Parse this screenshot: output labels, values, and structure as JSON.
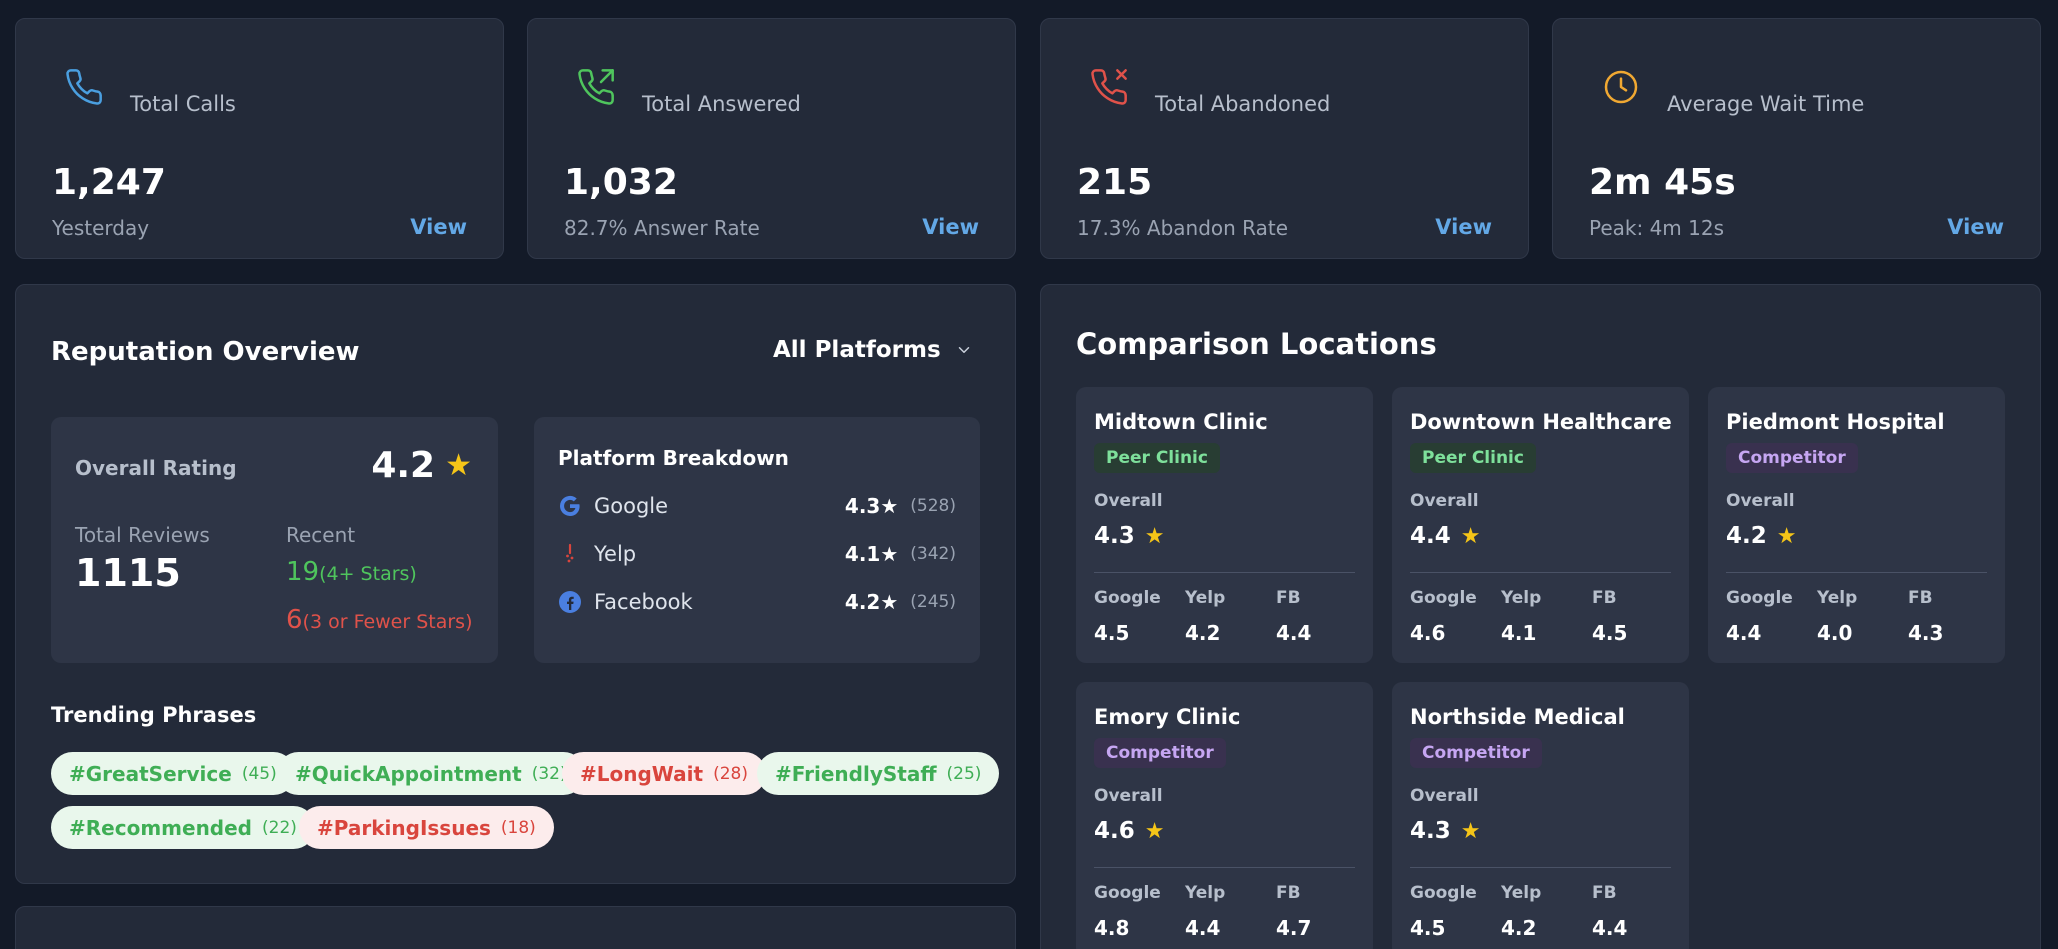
{
  "stats": [
    {
      "title": "Total Calls",
      "value": "1,247",
      "sub": "Yesterday",
      "view": "View",
      "icon": "phone-icon",
      "color": "#4a9fe0"
    },
    {
      "title": "Total Answered",
      "value": "1,032",
      "sub": "82.7% Answer Rate",
      "view": "View",
      "icon": "phone-outgoing-icon",
      "color": "#4fc55d"
    },
    {
      "title": "Total Abandoned",
      "value": "215",
      "sub": "17.3% Abandon Rate",
      "view": "View",
      "icon": "phone-missed-icon",
      "color": "#e0524a"
    },
    {
      "title": "Average Wait Time",
      "value": "2m 45s",
      "sub": "Peak: 4m 12s",
      "view": "View",
      "icon": "clock-icon",
      "color": "#f0a832"
    }
  ],
  "reputation": {
    "title": "Reputation Overview",
    "platform_filter": "All Platforms",
    "overall_label": "Overall Rating",
    "overall_value": "4.2",
    "total_reviews_label": "Total Reviews",
    "total_reviews_value": "1115",
    "recent_label": "Recent",
    "recent_positive_count": "19",
    "recent_positive_text": "(4+ Stars)",
    "recent_negative_count": "6",
    "recent_negative_text": "(3 or Fewer Stars)",
    "breakdown_title": "Platform Breakdown",
    "platforms": [
      {
        "name": "Google",
        "rating": "4.3★",
        "count": "(528)",
        "icon": "google-icon"
      },
      {
        "name": "Yelp",
        "rating": "4.1★",
        "count": "(342)",
        "icon": "yelp-icon"
      },
      {
        "name": "Facebook",
        "rating": "4.2★",
        "count": "(245)",
        "icon": "facebook-icon"
      }
    ],
    "trending_title": "Trending Phrases",
    "tags": [
      {
        "text": "#GreatService",
        "count": "(45)",
        "sentiment": "positive"
      },
      {
        "text": "#QuickAppointment",
        "count": "(32)",
        "sentiment": "positive"
      },
      {
        "text": "#LongWait",
        "count": "(28)",
        "sentiment": "negative"
      },
      {
        "text": "#FriendlyStaff",
        "count": "(25)",
        "sentiment": "positive"
      },
      {
        "text": "#Recommended",
        "count": "(22)",
        "sentiment": "positive"
      },
      {
        "text": "#ParkingIssues",
        "count": "(18)",
        "sentiment": "negative"
      }
    ]
  },
  "comparison": {
    "title": "Comparison Locations",
    "overall_label": "Overall",
    "platform_labels": [
      "Google",
      "Yelp",
      "FB"
    ],
    "locations": [
      {
        "name": "Midtown Clinic",
        "badge": "Peer Clinic",
        "type": "peer",
        "overall": "4.3",
        "google": "4.5",
        "yelp": "4.2",
        "fb": "4.4"
      },
      {
        "name": "Downtown Healthcare",
        "badge": "Peer Clinic",
        "type": "peer",
        "overall": "4.4",
        "google": "4.6",
        "yelp": "4.1",
        "fb": "4.5"
      },
      {
        "name": "Piedmont Hospital",
        "badge": "Competitor",
        "type": "competitor",
        "overall": "4.2",
        "google": "4.4",
        "yelp": "4.0",
        "fb": "4.3"
      },
      {
        "name": "Emory Clinic",
        "badge": "Competitor",
        "type": "competitor",
        "overall": "4.6",
        "google": "4.8",
        "yelp": "4.4",
        "fb": "4.7"
      },
      {
        "name": "Northside Medical",
        "badge": "Competitor",
        "type": "competitor",
        "overall": "4.3",
        "google": "4.5",
        "yelp": "4.2",
        "fb": "4.4"
      }
    ]
  }
}
